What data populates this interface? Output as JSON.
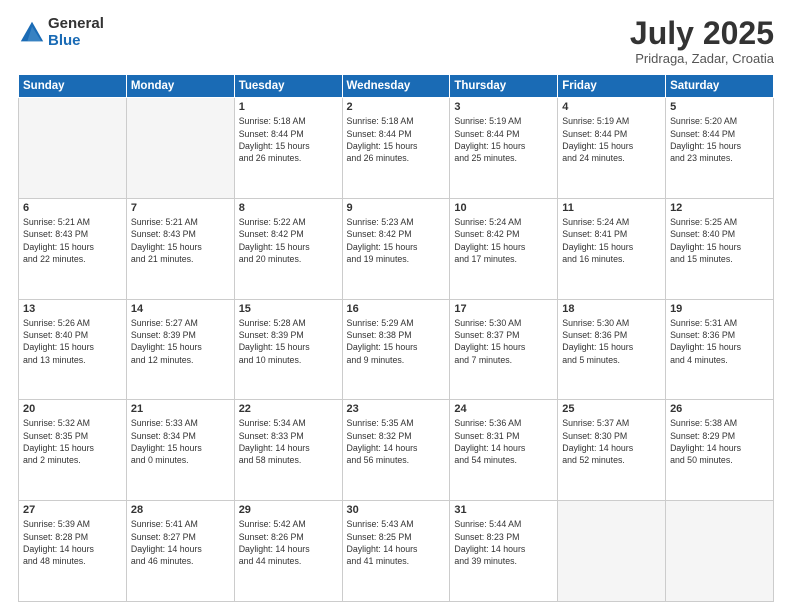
{
  "header": {
    "logo_general": "General",
    "logo_blue": "Blue",
    "month": "July 2025",
    "location": "Pridraga, Zadar, Croatia"
  },
  "weekdays": [
    "Sunday",
    "Monday",
    "Tuesday",
    "Wednesday",
    "Thursday",
    "Friday",
    "Saturday"
  ],
  "weeks": [
    [
      {
        "day": "",
        "info": ""
      },
      {
        "day": "",
        "info": ""
      },
      {
        "day": "1",
        "info": "Sunrise: 5:18 AM\nSunset: 8:44 PM\nDaylight: 15 hours\nand 26 minutes."
      },
      {
        "day": "2",
        "info": "Sunrise: 5:18 AM\nSunset: 8:44 PM\nDaylight: 15 hours\nand 26 minutes."
      },
      {
        "day": "3",
        "info": "Sunrise: 5:19 AM\nSunset: 8:44 PM\nDaylight: 15 hours\nand 25 minutes."
      },
      {
        "day": "4",
        "info": "Sunrise: 5:19 AM\nSunset: 8:44 PM\nDaylight: 15 hours\nand 24 minutes."
      },
      {
        "day": "5",
        "info": "Sunrise: 5:20 AM\nSunset: 8:44 PM\nDaylight: 15 hours\nand 23 minutes."
      }
    ],
    [
      {
        "day": "6",
        "info": "Sunrise: 5:21 AM\nSunset: 8:43 PM\nDaylight: 15 hours\nand 22 minutes."
      },
      {
        "day": "7",
        "info": "Sunrise: 5:21 AM\nSunset: 8:43 PM\nDaylight: 15 hours\nand 21 minutes."
      },
      {
        "day": "8",
        "info": "Sunrise: 5:22 AM\nSunset: 8:42 PM\nDaylight: 15 hours\nand 20 minutes."
      },
      {
        "day": "9",
        "info": "Sunrise: 5:23 AM\nSunset: 8:42 PM\nDaylight: 15 hours\nand 19 minutes."
      },
      {
        "day": "10",
        "info": "Sunrise: 5:24 AM\nSunset: 8:42 PM\nDaylight: 15 hours\nand 17 minutes."
      },
      {
        "day": "11",
        "info": "Sunrise: 5:24 AM\nSunset: 8:41 PM\nDaylight: 15 hours\nand 16 minutes."
      },
      {
        "day": "12",
        "info": "Sunrise: 5:25 AM\nSunset: 8:40 PM\nDaylight: 15 hours\nand 15 minutes."
      }
    ],
    [
      {
        "day": "13",
        "info": "Sunrise: 5:26 AM\nSunset: 8:40 PM\nDaylight: 15 hours\nand 13 minutes."
      },
      {
        "day": "14",
        "info": "Sunrise: 5:27 AM\nSunset: 8:39 PM\nDaylight: 15 hours\nand 12 minutes."
      },
      {
        "day": "15",
        "info": "Sunrise: 5:28 AM\nSunset: 8:39 PM\nDaylight: 15 hours\nand 10 minutes."
      },
      {
        "day": "16",
        "info": "Sunrise: 5:29 AM\nSunset: 8:38 PM\nDaylight: 15 hours\nand 9 minutes."
      },
      {
        "day": "17",
        "info": "Sunrise: 5:30 AM\nSunset: 8:37 PM\nDaylight: 15 hours\nand 7 minutes."
      },
      {
        "day": "18",
        "info": "Sunrise: 5:30 AM\nSunset: 8:36 PM\nDaylight: 15 hours\nand 5 minutes."
      },
      {
        "day": "19",
        "info": "Sunrise: 5:31 AM\nSunset: 8:36 PM\nDaylight: 15 hours\nand 4 minutes."
      }
    ],
    [
      {
        "day": "20",
        "info": "Sunrise: 5:32 AM\nSunset: 8:35 PM\nDaylight: 15 hours\nand 2 minutes."
      },
      {
        "day": "21",
        "info": "Sunrise: 5:33 AM\nSunset: 8:34 PM\nDaylight: 15 hours\nand 0 minutes."
      },
      {
        "day": "22",
        "info": "Sunrise: 5:34 AM\nSunset: 8:33 PM\nDaylight: 14 hours\nand 58 minutes."
      },
      {
        "day": "23",
        "info": "Sunrise: 5:35 AM\nSunset: 8:32 PM\nDaylight: 14 hours\nand 56 minutes."
      },
      {
        "day": "24",
        "info": "Sunrise: 5:36 AM\nSunset: 8:31 PM\nDaylight: 14 hours\nand 54 minutes."
      },
      {
        "day": "25",
        "info": "Sunrise: 5:37 AM\nSunset: 8:30 PM\nDaylight: 14 hours\nand 52 minutes."
      },
      {
        "day": "26",
        "info": "Sunrise: 5:38 AM\nSunset: 8:29 PM\nDaylight: 14 hours\nand 50 minutes."
      }
    ],
    [
      {
        "day": "27",
        "info": "Sunrise: 5:39 AM\nSunset: 8:28 PM\nDaylight: 14 hours\nand 48 minutes."
      },
      {
        "day": "28",
        "info": "Sunrise: 5:41 AM\nSunset: 8:27 PM\nDaylight: 14 hours\nand 46 minutes."
      },
      {
        "day": "29",
        "info": "Sunrise: 5:42 AM\nSunset: 8:26 PM\nDaylight: 14 hours\nand 44 minutes."
      },
      {
        "day": "30",
        "info": "Sunrise: 5:43 AM\nSunset: 8:25 PM\nDaylight: 14 hours\nand 41 minutes."
      },
      {
        "day": "31",
        "info": "Sunrise: 5:44 AM\nSunset: 8:23 PM\nDaylight: 14 hours\nand 39 minutes."
      },
      {
        "day": "",
        "info": ""
      },
      {
        "day": "",
        "info": ""
      }
    ]
  ]
}
